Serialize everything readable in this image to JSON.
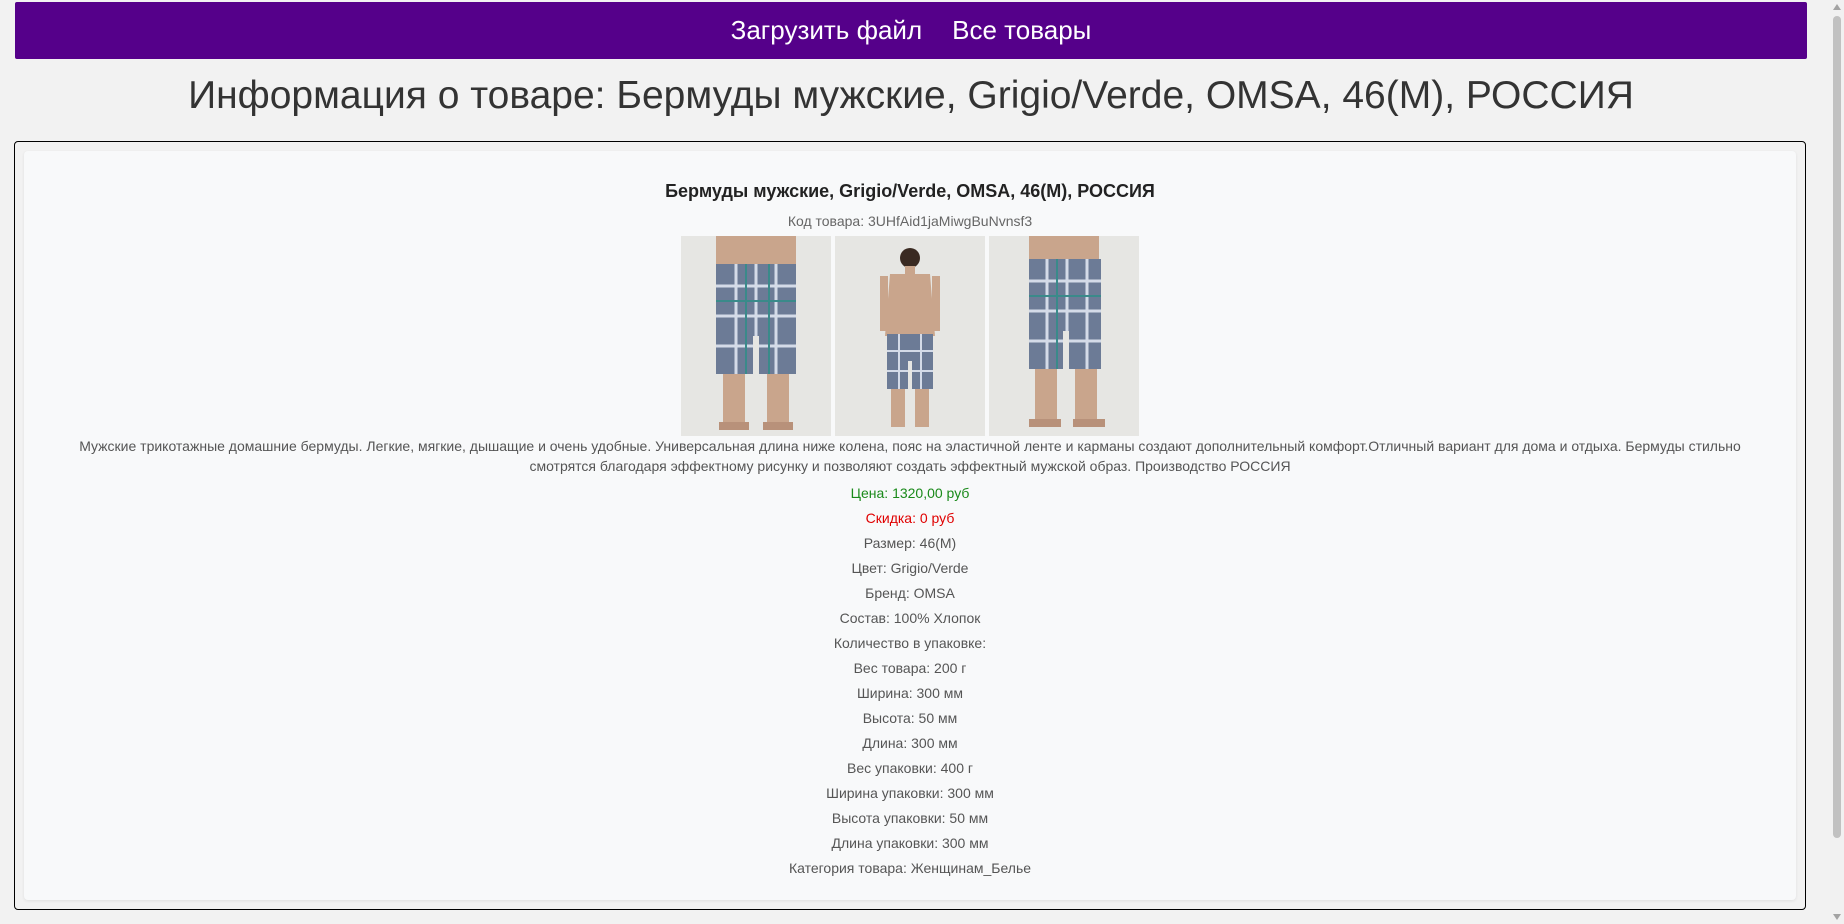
{
  "nav": {
    "upload_label": "Загрузить файл",
    "all_products_label": "Все товары"
  },
  "page_title": "Информация о товаре: Бермуды мужские, Grigio/Verde, OMSA, 46(M), РОССИЯ",
  "product": {
    "name": "Бермуды мужские, Grigio/Verde, OMSA, 46(M), РОССИЯ",
    "code": "Код товара: 3UHfAid1jaMiwgBuNvnsf3",
    "description": "Мужские трикотажные домашние бермуды. Легкие, мягкие, дышащие и очень удобные. Универсальная длина ниже колена, пояс на эластичной ленте и карманы создают дополнительный комфорт.Отличный вариант для дома и отдыха. Бермуды стильно смотрятся благодаря эффектному рисунку и позволяют создать эффектный мужской образ. Производство РОССИЯ",
    "price": "Цена: 1320,00 руб",
    "discount": "Скидка: 0 руб",
    "size": "Размер: 46(M)",
    "color": "Цвет: Grigio/Verde",
    "brand": "Бренд: OMSA",
    "composition": "Состав: 100% Хлопок",
    "pack_quantity": "Количество в упаковке:",
    "weight": "Вес товара: 200 г",
    "width": "Ширина: 300 мм",
    "height": "Высота: 50 мм",
    "length": "Длина: 300 мм",
    "pack_weight": "Вес упаковки: 400 г",
    "pack_width": "Ширина упаковки: 300 мм",
    "pack_height": "Высота упаковки: 50 мм",
    "pack_length": "Длина упаковки: 300 мм",
    "category": "Категория товара: Женщинам_Белье"
  },
  "colors": {
    "navbar": "#55008a",
    "price": "#1a8a1a",
    "discount": "#e00000"
  }
}
